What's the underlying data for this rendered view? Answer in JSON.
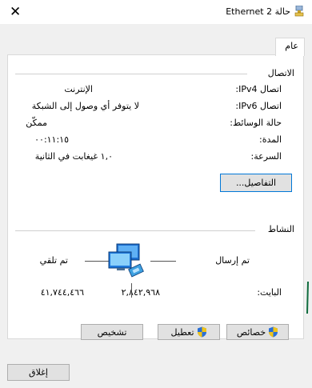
{
  "window": {
    "title": "حالة Ethernet 2",
    "close_glyph": "✕"
  },
  "tabs": [
    {
      "label": "عام"
    }
  ],
  "connection": {
    "heading": "الاتصال",
    "rows": [
      {
        "label": "اتصال IPv4:",
        "value": "الإنترنت"
      },
      {
        "label": "اتصال IPv6:",
        "value": "لا يتوفر أي وصول إلى الشبكة"
      },
      {
        "label": "حالة الوسائط:",
        "value": "ممكّن"
      },
      {
        "label": "المدة:",
        "value": "٠٠:١١:١٥"
      },
      {
        "label": "السرعة:",
        "value": "١,٠ غيغابت في الثانية"
      }
    ],
    "details_button": "التفاصيل..."
  },
  "activity": {
    "heading": "النشاط",
    "sent_label": "تم إرسال",
    "received_label": "تم تلقي",
    "bytes_label": "البايت:",
    "bytes_sent": "٢,٨٤٢,٩٦٨",
    "bytes_received": "٤١,٧٤٤,٤٦٦"
  },
  "buttons": {
    "properties": "خصائص",
    "disable": "تعطيل",
    "diagnose": "تشخيص",
    "close": "إغلاق"
  },
  "colors": {
    "accent": "#0078d7",
    "window_bg": "#f0f0f0",
    "panel_bg": "#ffffff"
  },
  "icons": [
    "close-icon",
    "network-adapter-icon",
    "computers-activity-icon",
    "uac-shield-icon"
  ]
}
